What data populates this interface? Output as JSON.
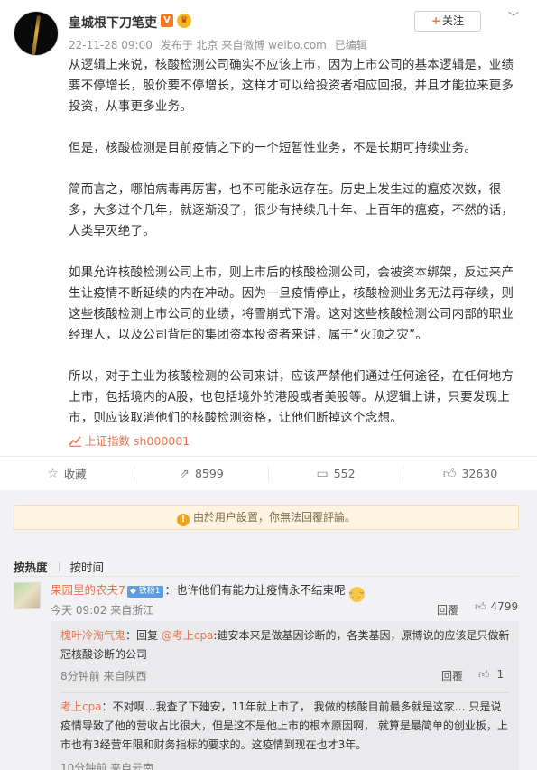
{
  "post": {
    "author": "皇城根下刀笔吏",
    "verified_badge": "V",
    "meta": {
      "time": "22-11-28 09:00",
      "source": "发布于 北京 来自微博 weibo.com",
      "edited": "已编辑"
    },
    "follow_label": "关注",
    "paragraphs": [
      "从逻辑上来说，核酸检测公司确实不应该上市，因为上市公司的基本逻辑是，业绩要不停增长，股价要不停增长，这样才可以给投资者相应回报，并且才能拉来更多投资，从事更多业务。",
      "但是，核酸检测是目前疫情之下的一个短暂性业务，不是长期可持续业务。",
      "简而言之，哪怕病毒再厉害，也不可能永远存在。历史上发生过的瘟疫次数，很多，大多过个几年，就逐渐没了，很少有持续几十年、上百年的瘟疫，不然的话，人类早灭绝了。",
      "如果允许核酸检测公司上市，则上市后的核酸检测公司，会被资本绑架，反过来产生让疫情不断延续的内在冲动。因为一旦疫情停止，核酸检测业务无法再存续，则这些核酸检测上市公司的业绩，将雪崩式下滑。这对这些核酸检测公司内部的职业经理人，以及公司背后的集团资本投资者来讲，属于“灭顶之灾”。",
      "所以，对于主业为核酸检测的公司来讲，应该严禁他们通过任何途径，在任何地方上市，包括境内的A股，也包括境外的港股或者美股等。从逻辑上讲，只要发现上市，则应该取消他们的核酸检测资格，让他们断掉这个念想。"
    ],
    "stock_tag": "上证指数 sh000001",
    "actions": {
      "favorite": "收藏",
      "forward": "8599",
      "comment": "552",
      "like": "32630"
    }
  },
  "comments": {
    "notice": "由於用户設置，你無法回覆評論。",
    "sort": {
      "hot": "按热度",
      "time": "按时间"
    },
    "top": {
      "user": "果园里的农夫7",
      "fan_badge": "铁粉1",
      "text": "：也许他们有能力让疫情永不结束呢",
      "time": "今天 09:02 来自浙江",
      "reply_label": "回覆",
      "likes": "4799"
    },
    "replies": [
      {
        "user": "槐叶冷淘气鬼",
        "text_prefix": "：回复 ",
        "mention": "@考上cpa",
        "text": ":廸安本来是做基因诊断的，各类基因，原博说的应该是只做新冠核酸诊断的公司",
        "time": "8分钟前 来自陕西",
        "reply_label": "回覆",
        "likes": "1"
      },
      {
        "user": "考上cpa",
        "text": "：不对啊…我查了下廸安，11年就上市了， 我做的核酸目前最多就是这家… 只是说疫情导致了他的营收占比很大，但是这不是他上市的根本原因啊， 就算是最简单的创业板，上市也有3经营年限和财务指标的要求的。这疫情到现在也才3年。",
        "time": "10分钟前 来自云南"
      }
    ]
  }
}
